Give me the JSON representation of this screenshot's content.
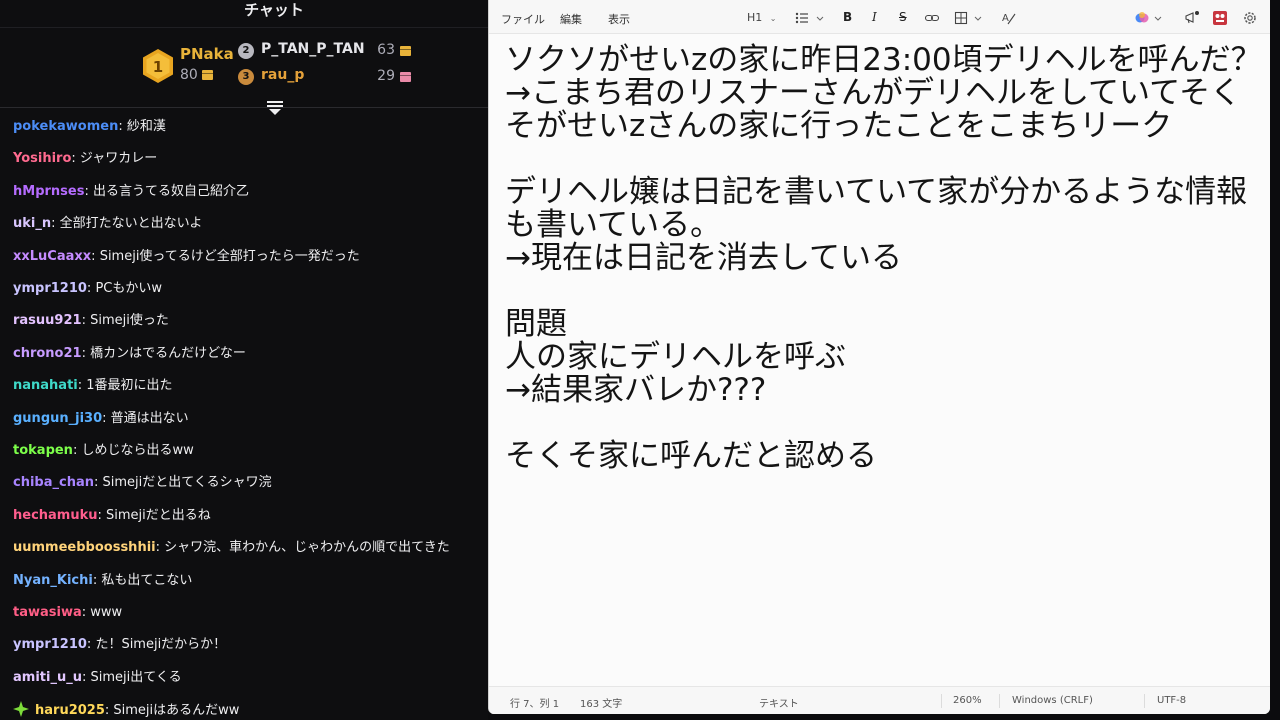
{
  "chat": {
    "title": "チャット",
    "leaderboard": {
      "first": {
        "rank": "1",
        "name": "PNaka",
        "score": "80"
      },
      "second": {
        "rank": "2",
        "name": "P_TAN_P_TAN",
        "score": "63"
      },
      "third": {
        "rank": "3",
        "name": "rau_p",
        "score": "29"
      }
    },
    "messages": [
      {
        "user": "pokekawomen",
        "color": "#4c8df6",
        "text": "紗和漢"
      },
      {
        "user": "Yosihiro",
        "color": "#ff6a8f",
        "text": "ジャワカレー"
      },
      {
        "user": "hMprnses",
        "color": "#b56cff",
        "text": "出る言うてる奴自己紹介乙"
      },
      {
        "user": "uki_n",
        "color": "#d9c6ff",
        "text": "全部打たないと出ないよ"
      },
      {
        "user": "xxLuCaaxx",
        "color": "#c58bff",
        "text": "Simeji使ってるけど全部打ったら一発だった"
      },
      {
        "user": "ympr1210",
        "color": "#c9c4ff",
        "text": "PCもかいw"
      },
      {
        "user": "rasuu921",
        "color": "#e3c2ff",
        "text": "Simeji使った"
      },
      {
        "user": "chrono21",
        "color": "#c79cff",
        "text": "橋カンはでるんだけどなー"
      },
      {
        "user": "nanahati",
        "color": "#3fd9c9",
        "text": "1番最初に出た"
      },
      {
        "user": "gungun_ji30",
        "color": "#5ab0ff",
        "text": "普通は出ない"
      },
      {
        "user": "tokapen",
        "color": "#7dff4a",
        "text": "しめじなら出るww"
      },
      {
        "user": "chiba_chan",
        "color": "#a884ff",
        "text": "Simejiだと出てくるシャワ浣"
      },
      {
        "user": "hechamuku",
        "color": "#ff5e8e",
        "text": "Simejiだと出るね"
      },
      {
        "user": "uummeebboosshhii",
        "color": "#ffd37a",
        "text": "シャワ浣、車わかん、じゃわかんの順で出てきた"
      },
      {
        "user": "Nyan_Kichi",
        "color": "#74b2ff",
        "text": "私も出てこない"
      },
      {
        "user": "tawasiwa",
        "color": "#ff5e86",
        "text": "www"
      },
      {
        "user": "ympr1210",
        "color": "#c9c4ff",
        "text": "た！Simejiだからか！"
      },
      {
        "user": "amiti_u_u",
        "color": "#e2c7ff",
        "text": "Simeji出てくる"
      },
      {
        "user": "haru2025",
        "color": "#ffd85a",
        "text": "Simejiはあるんだww",
        "icon": "sparkle-icon"
      }
    ]
  },
  "notepad": {
    "menu": {
      "file": "ファイル",
      "edit": "編集",
      "view": "表示"
    },
    "toolbar": {
      "heading": "H1"
    },
    "document_text": "ソクソがせいzの家に昨日23:00頃デリヘルを呼んだ？\n→こまち君のリスナーさんがデリヘルをしていてそくそがせいzさんの家に行ったことをこまちリーク\n\nデリヘル嬢は日記を書いていて家が分かるような情報も書いている。\n→現在は日記を消去している\n\n問題\n人の家にデリヘルを呼ぶ\n→結果家バレか???\n\nそくそ家に呼んだと認める",
    "status": {
      "position": "行 7、列 1",
      "chars": "163 文字",
      "format": "テキスト",
      "zoom": "260%",
      "line_ending": "Windows (CRLF)",
      "encoding": "UTF-8"
    }
  }
}
